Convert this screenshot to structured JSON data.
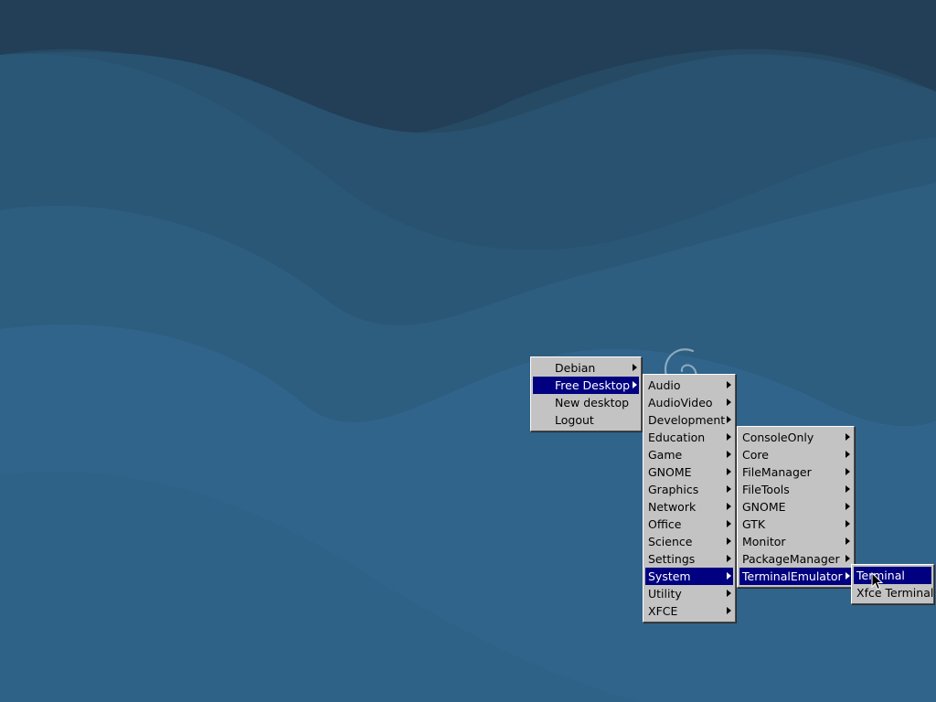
{
  "desktop": {
    "background_colors": [
      "#264a63",
      "#2a5674",
      "#2e6285"
    ],
    "logo_icon": "debian-swirl-icon"
  },
  "menus": {
    "root": {
      "items": [
        {
          "label": "Debian",
          "has_submenu": true,
          "active": false
        },
        {
          "label": "Free Desktop",
          "has_submenu": true,
          "active": true
        },
        {
          "label": "New desktop",
          "has_submenu": false,
          "active": false
        },
        {
          "label": "Logout",
          "has_submenu": false,
          "active": false
        }
      ]
    },
    "free_desktop": {
      "items": [
        {
          "label": "Audio",
          "has_submenu": true,
          "active": false
        },
        {
          "label": "AudioVideo",
          "has_submenu": true,
          "active": false
        },
        {
          "label": "Development",
          "has_submenu": true,
          "active": false
        },
        {
          "label": "Education",
          "has_submenu": true,
          "active": false
        },
        {
          "label": "Game",
          "has_submenu": true,
          "active": false
        },
        {
          "label": "GNOME",
          "has_submenu": true,
          "active": false
        },
        {
          "label": "Graphics",
          "has_submenu": true,
          "active": false
        },
        {
          "label": "Network",
          "has_submenu": true,
          "active": false
        },
        {
          "label": "Office",
          "has_submenu": true,
          "active": false
        },
        {
          "label": "Science",
          "has_submenu": true,
          "active": false
        },
        {
          "label": "Settings",
          "has_submenu": true,
          "active": false
        },
        {
          "label": "System",
          "has_submenu": true,
          "active": true
        },
        {
          "label": "Utility",
          "has_submenu": true,
          "active": false
        },
        {
          "label": "XFCE",
          "has_submenu": true,
          "active": false
        }
      ]
    },
    "system": {
      "items": [
        {
          "label": "ConsoleOnly",
          "has_submenu": true,
          "active": false
        },
        {
          "label": "Core",
          "has_submenu": true,
          "active": false
        },
        {
          "label": "FileManager",
          "has_submenu": true,
          "active": false
        },
        {
          "label": "FileTools",
          "has_submenu": true,
          "active": false
        },
        {
          "label": "GNOME",
          "has_submenu": true,
          "active": false
        },
        {
          "label": "GTK",
          "has_submenu": true,
          "active": false
        },
        {
          "label": "Monitor",
          "has_submenu": true,
          "active": false
        },
        {
          "label": "PackageManager",
          "has_submenu": true,
          "active": false
        },
        {
          "label": "TerminalEmulator",
          "has_submenu": true,
          "active": true
        }
      ]
    },
    "terminal_emulator": {
      "items": [
        {
          "label": "Terminal",
          "has_submenu": false,
          "active": true
        },
        {
          "label": "Xfce Terminal",
          "has_submenu": false,
          "active": false
        }
      ]
    }
  },
  "colors": {
    "menu_bg": "#c3c3c3",
    "highlight_bg": "#000080",
    "highlight_text": "#ffffff"
  },
  "cursor": {
    "icon": "arrow-pointer-icon"
  }
}
